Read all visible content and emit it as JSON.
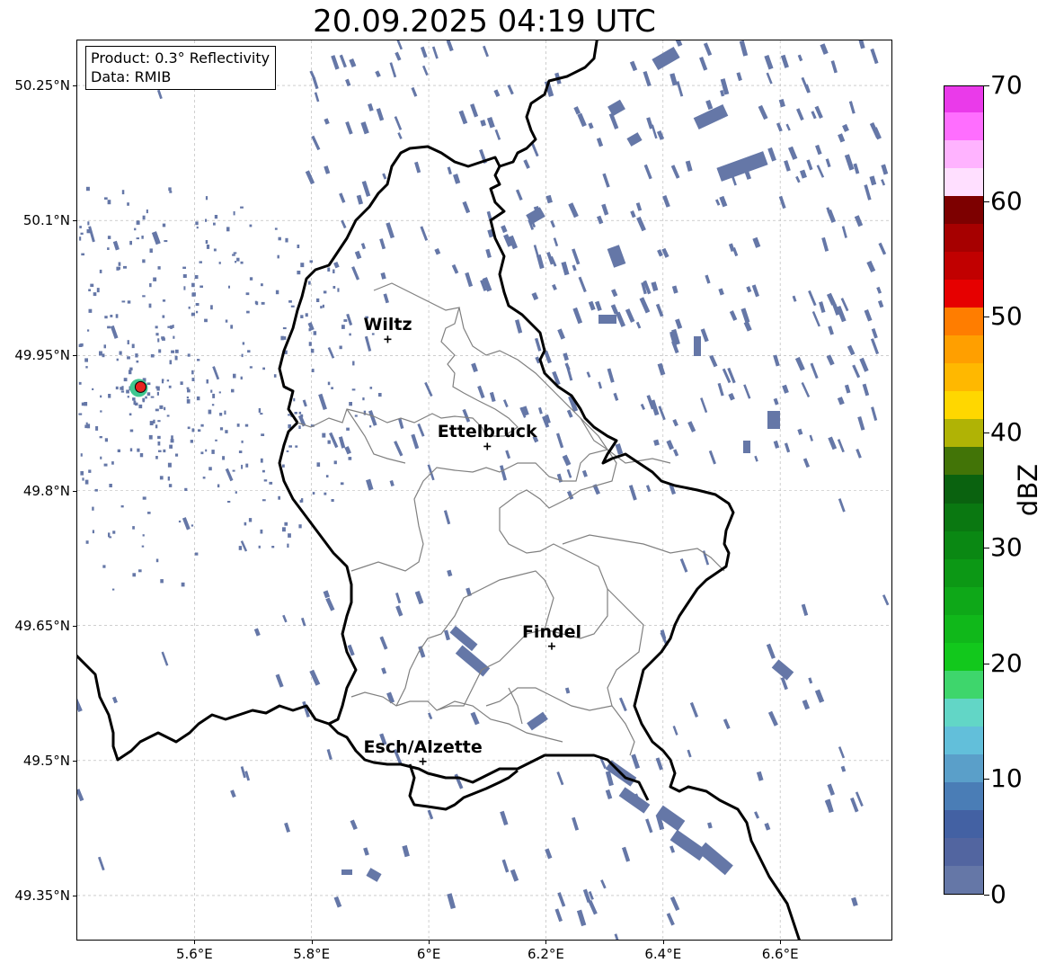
{
  "title": "20.09.2025 04:19 UTC",
  "info_box": {
    "product": "Product: 0.3° Reflectivity",
    "data": "Data: RMIB"
  },
  "axes": {
    "lat_ticks": [
      "50.25°N",
      "50.1°N",
      "49.95°N",
      "49.8°N",
      "49.65°N",
      "49.5°N",
      "49.35°N"
    ],
    "lat_values": [
      50.25,
      50.1,
      49.95,
      49.8,
      49.65,
      49.5,
      49.35
    ],
    "lon_ticks": [
      "5.6°E",
      "5.8°E",
      "6°E",
      "6.2°E",
      "6.4°E",
      "6.6°E"
    ],
    "lon_values": [
      5.6,
      5.8,
      6.0,
      6.2,
      6.4,
      6.6
    ],
    "lon_range": [
      5.4,
      6.79
    ],
    "lat_range": [
      49.3,
      50.3
    ],
    "grid": true
  },
  "cities": [
    {
      "name": "Wiltz",
      "lon": 5.93,
      "lat": 49.968
    },
    {
      "name": "Ettelbruck",
      "lon": 6.1,
      "lat": 49.849
    },
    {
      "name": "Findel",
      "lon": 6.21,
      "lat": 49.627
    },
    {
      "name": "Esch/Alzette",
      "lon": 5.99,
      "lat": 49.499
    }
  ],
  "radar_site": {
    "lon": 5.505,
    "lat": 49.914,
    "marker_color": "#e8231f"
  },
  "colorbar": {
    "label": "dBZ",
    "ticks": [
      "0",
      "10",
      "20",
      "30",
      "40",
      "50",
      "60",
      "70"
    ],
    "min": 0,
    "max": 70,
    "colors": [
      "#6577a7",
      "#5265a0",
      "#4361a3",
      "#4a7db6",
      "#5a9fc9",
      "#62bfda",
      "#62d6c6",
      "#3ed66c",
      "#12c81c",
      "#10b81a",
      "#0ea818",
      "#0c9815",
      "#0a8813",
      "#0a7811",
      "#0a620f",
      "#427407",
      "#b0b305",
      "#ffd700",
      "#ffb800",
      "#ff9f00",
      "#ff7d00",
      "#e60000",
      "#c10000",
      "#a60000",
      "#7d0000",
      "#ffdfff",
      "#ffb3ff",
      "#ff6eff",
      "#ea3aea"
    ]
  },
  "colors": {
    "border": "#000000",
    "canton_lines": "#808080",
    "echo": "#6577a7",
    "grid": "#b0b0b0"
  }
}
